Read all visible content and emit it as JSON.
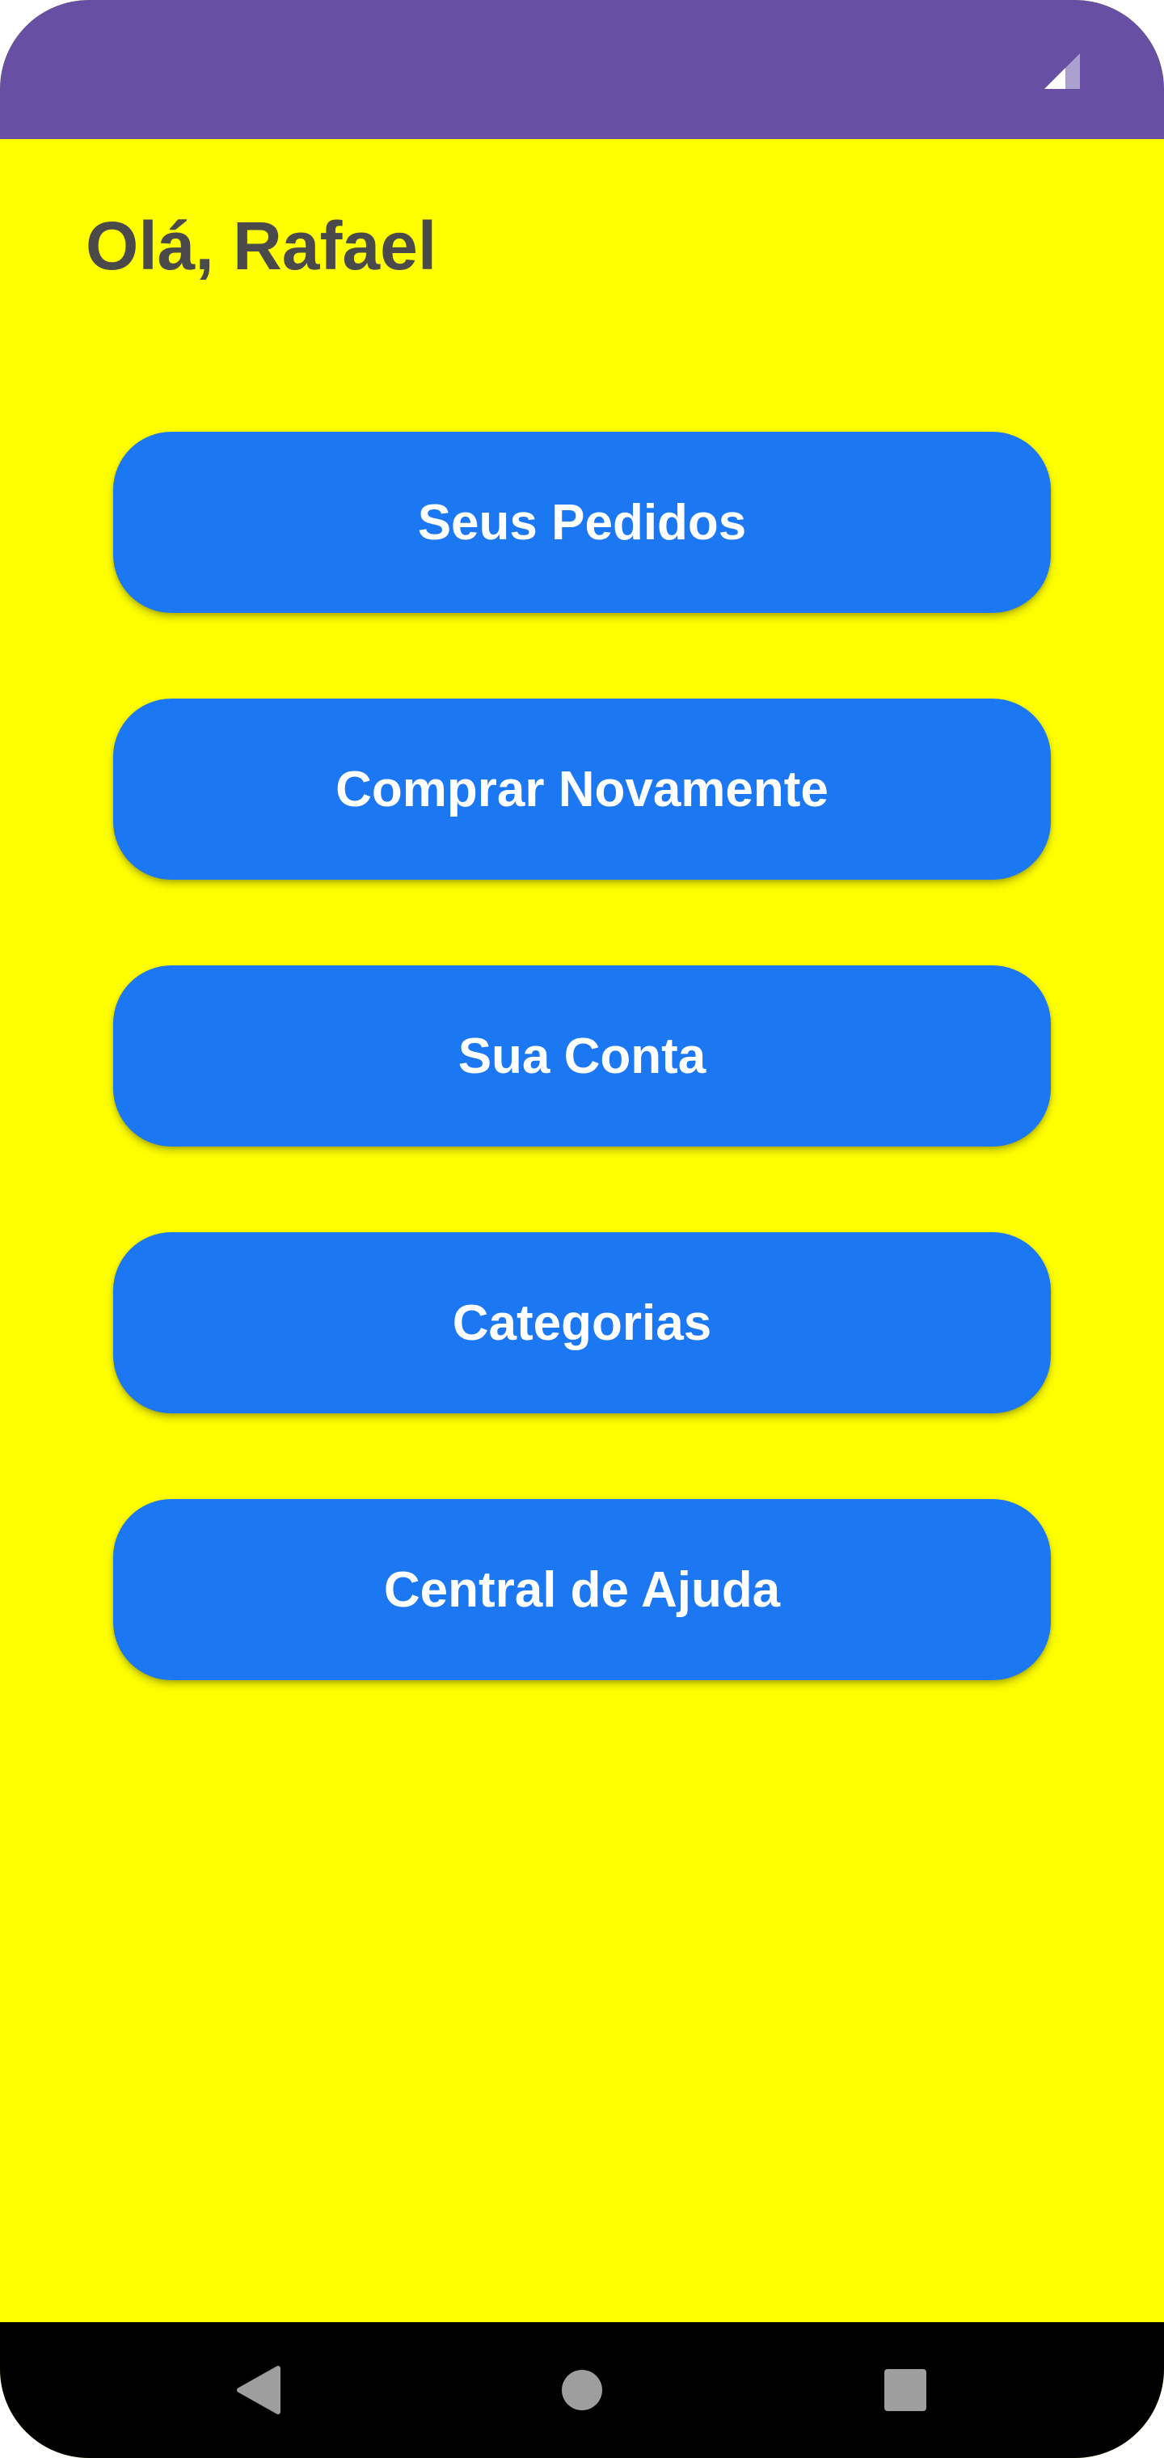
{
  "status_bar": {
    "background_color": "#6750a4",
    "icons": [
      "signal-icon"
    ]
  },
  "screen": {
    "background_color": "#ffff00",
    "greeting": "Olá, Rafael"
  },
  "menu": {
    "button_color": "#1b77f2",
    "items": [
      {
        "label": "Seus Pedidos"
      },
      {
        "label": "Comprar Novamente"
      },
      {
        "label": "Sua Conta"
      },
      {
        "label": "Categorias"
      },
      {
        "label": "Central de Ajuda"
      }
    ]
  },
  "nav_bar": {
    "background_color": "#000000",
    "icons": [
      "back-icon",
      "home-icon",
      "recents-icon"
    ]
  }
}
